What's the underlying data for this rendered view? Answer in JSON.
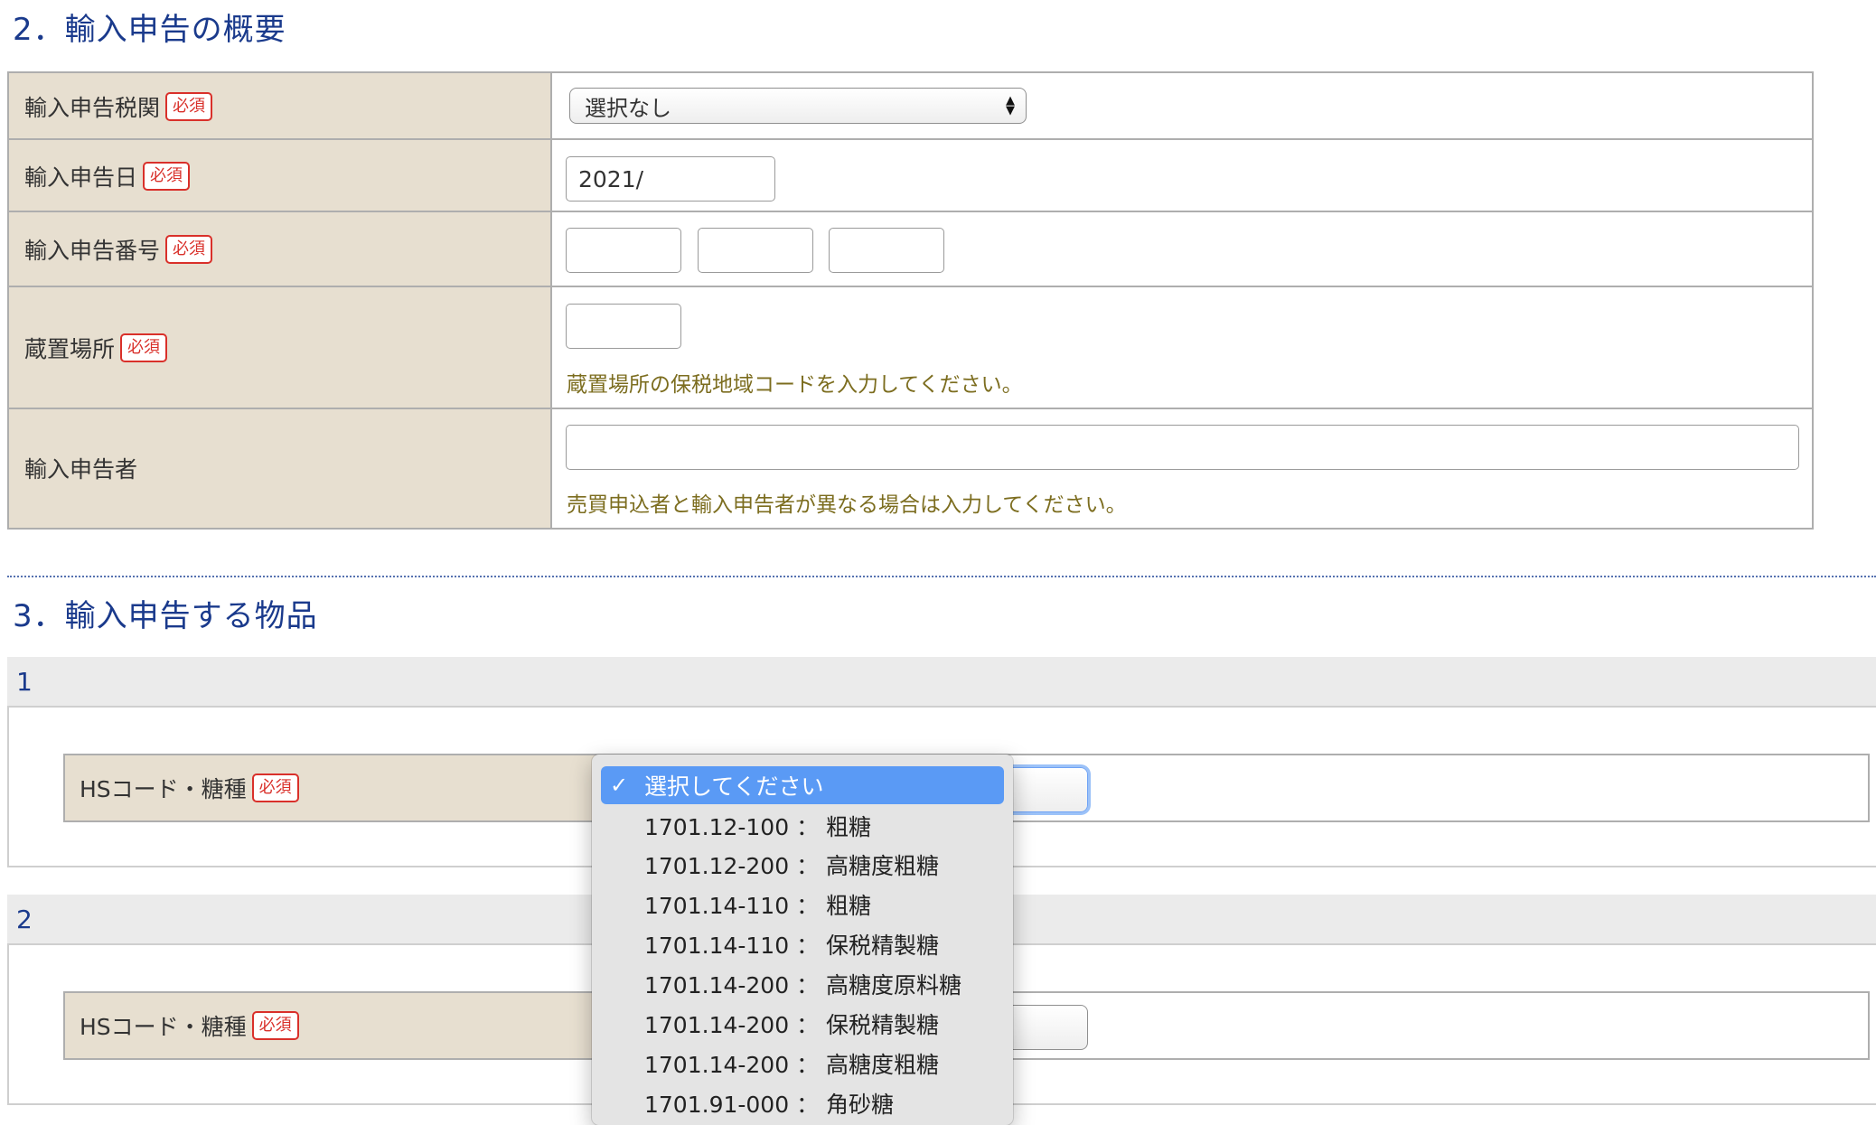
{
  "section2": {
    "title": "2．輸入申告の概要",
    "required_badge": "必須",
    "customs": {
      "label": "輸入申告税関",
      "selected": "選択なし"
    },
    "date": {
      "label": "輸入申告日",
      "value": "2021/"
    },
    "number": {
      "label": "輸入申告番号"
    },
    "storage": {
      "label": "蔵置場所",
      "note": "蔵置場所の保税地域コードを入力してください。"
    },
    "declarant": {
      "label": "輸入申告者",
      "note": "売買申込者と輸入申告者が異なる場合は入力してください。"
    }
  },
  "section3": {
    "title": "3．輸入申告する物品",
    "items": [
      {
        "index": "1",
        "hs_label": "HSコード・糖種"
      },
      {
        "index": "2",
        "hs_label": "HSコード・糖種"
      }
    ]
  },
  "dropdown": {
    "options": [
      "選択してください",
      "1701.12-100 ： 粗糖",
      "1701.12-200 ： 高糖度粗糖",
      "1701.14-110 ： 粗糖",
      "1701.14-110 ： 保税精製糖",
      "1701.14-200 ： 高糖度原料糖",
      "1701.14-200 ： 保税精製糖",
      "1701.14-200 ： 高糖度粗糖",
      "1701.91-000 ： 角砂糖"
    ],
    "selected_index": 0
  },
  "colors": {
    "title_blue": "#1a3a8c",
    "label_bg": "#e7dfd0",
    "required_red": "#d9302a",
    "note_olive": "#7c6d1f",
    "highlight_blue": "#5a9af5"
  }
}
